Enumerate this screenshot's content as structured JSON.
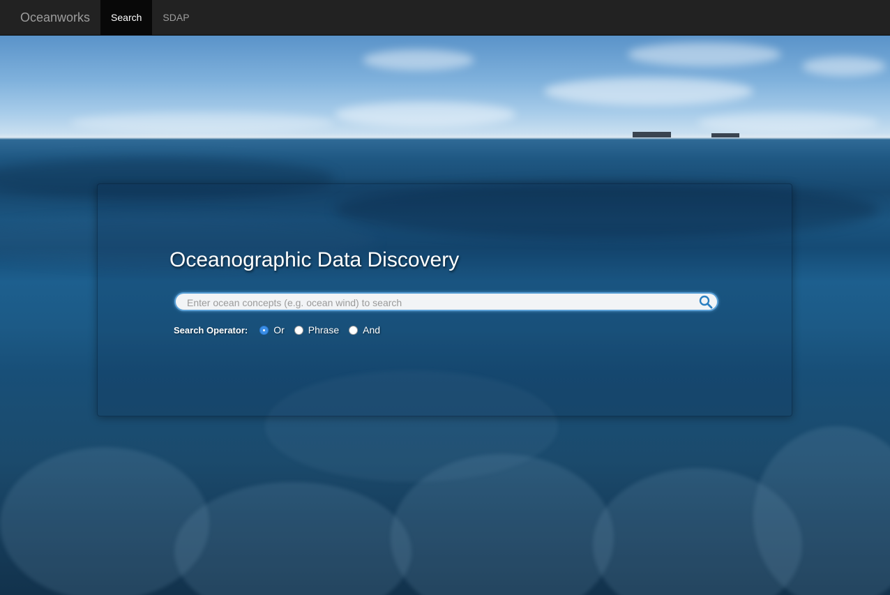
{
  "navbar": {
    "brand": "Oceanworks",
    "items": [
      {
        "label": "Search",
        "active": true
      },
      {
        "label": "SDAP",
        "active": false
      }
    ]
  },
  "hero": {
    "title": "Oceanographic Data Discovery"
  },
  "search": {
    "placeholder": "Enter ocean concepts (e.g. ocean wind) to search",
    "value": "",
    "icon": "search-icon"
  },
  "operator": {
    "label": "Search Operator:",
    "options": [
      {
        "label": "Or",
        "checked": true
      },
      {
        "label": "Phrase",
        "checked": false
      },
      {
        "label": "And",
        "checked": false
      }
    ]
  },
  "colors": {
    "navbar_bg": "#222222",
    "nav_active_bg": "#080808",
    "nav_text": "#9d9d9d",
    "search_border": "#5aa0d6",
    "radio_checked": "#3b8ee6"
  }
}
